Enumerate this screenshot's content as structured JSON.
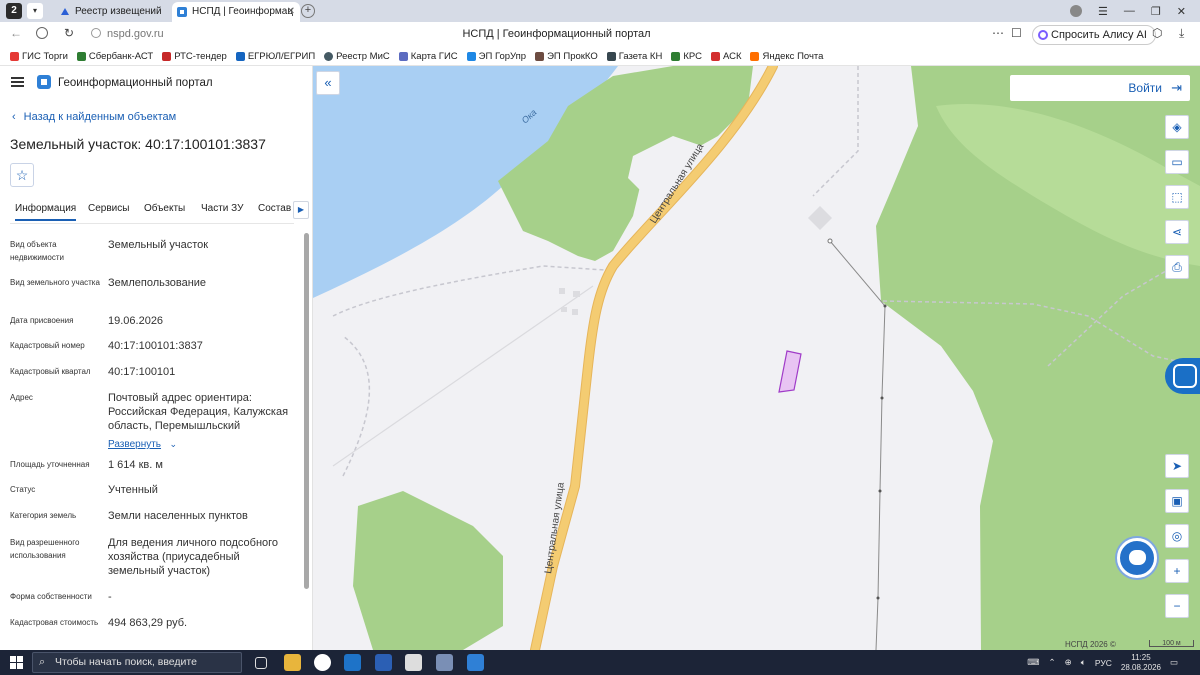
{
  "browser": {
    "tab_count": "2",
    "tabs": [
      {
        "title": "Реестр извещений"
      },
      {
        "title": "НСПД | Геоинформац"
      }
    ],
    "url": "nspd.gov.ru",
    "page_title": "НСПД | Геоинформационный портал",
    "alice_label": "Спросить Алису AI",
    "bookmarks": [
      {
        "label": "ГИС Торги",
        "color": "#e53935"
      },
      {
        "label": "Сбербанк-АСТ",
        "color": "#2e7d32"
      },
      {
        "label": "РТС-тендер",
        "color": "#c62828"
      },
      {
        "label": "ЕГРЮЛ/ЕГРИП",
        "color": "#1565c0"
      },
      {
        "label": "Реестр МиС",
        "color": "#455a64"
      },
      {
        "label": "Карта ГИС",
        "color": "#5c6bc0"
      },
      {
        "label": "ЭП ГорУпр",
        "color": "#1e88e5"
      },
      {
        "label": "ЭП ПрокКО",
        "color": "#6d4c41"
      },
      {
        "label": "Газета КН",
        "color": "#37474f"
      },
      {
        "label": "КРС",
        "color": "#2e7d32"
      },
      {
        "label": "АСК",
        "color": "#d32f2f"
      },
      {
        "label": "Яндекс Почта",
        "color": "#ff6f00"
      }
    ]
  },
  "app": {
    "title": "Геоинформационный портал",
    "back_label": "Назад к найденным объектам",
    "object_title": "Земельный участок: 40:17:100101:3837",
    "tabs": [
      "Информация",
      "Сервисы",
      "Объекты",
      "Части ЗУ",
      "Состав"
    ],
    "expand_label": "Развернуть",
    "details": [
      {
        "label": "Вид объекта недвижимости",
        "value": "Земельный участок"
      },
      {
        "label": "Вид земельного участка",
        "value": "Землепользование"
      },
      {
        "label": "Дата присвоения",
        "value": "19.06.2026"
      },
      {
        "label": "Кадастровый номер",
        "value": "40:17:100101:3837"
      },
      {
        "label": "Кадастровый квартал",
        "value": "40:17:100101"
      },
      {
        "label": "Адрес",
        "value": "Почтовый адрес ориентира: Российская Федерация, Калужская область, Перемышльский"
      },
      {
        "label": "Площадь уточненная",
        "value": "1 614 кв. м"
      },
      {
        "label": "Статус",
        "value": "Учтенный"
      },
      {
        "label": "Категория земель",
        "value": "Земли населенных пунктов"
      },
      {
        "label": "Вид разрешенного использования",
        "value": "Для ведения личного подсобного хозяйства (приусадебный земельный участок)"
      },
      {
        "label": "Форма собственности",
        "value": "-"
      },
      {
        "label": "Кадастровая стоимость",
        "value": "494 863,29 руб."
      }
    ]
  },
  "map": {
    "login_label": "Войти",
    "river_label": "Ока",
    "street_label": "Центральная улица",
    "copyright": "НСПД 2026 ©",
    "scale_label": "100 м",
    "colors": {
      "water": "#a9cff3",
      "forest": "#a6d08a",
      "road": "#f4cc72",
      "parcel": "#e8c4f3",
      "accent": "#1a5fb4"
    }
  },
  "taskbar": {
    "search_placeholder": "Чтобы начать поиск, введите",
    "language": "РУС",
    "time": "11:25",
    "date": "28.08.2026"
  }
}
